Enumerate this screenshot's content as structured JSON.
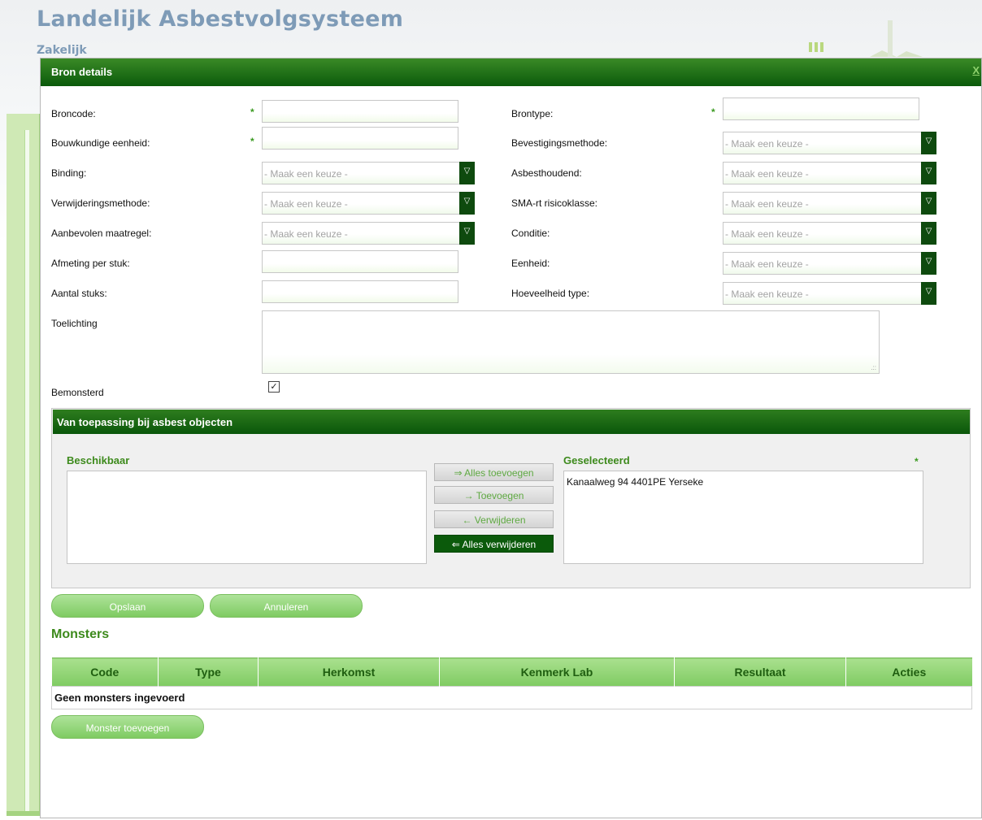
{
  "app": {
    "title": "Landelijk Asbestvolgsysteem",
    "subtitle": "Zakelijk"
  },
  "dialog": {
    "title": "Bron details",
    "close_label": "X"
  },
  "form": {
    "select_placeholder": "- Maak een keuze -",
    "fields": {
      "broncode": {
        "label": "Broncode:",
        "value": ""
      },
      "bouwkundige_eenheid": {
        "label": "Bouwkundige eenheid:",
        "value": ""
      },
      "binding": {
        "label": "Binding:",
        "value": "- Maak een keuze -"
      },
      "verwijderingsmethode": {
        "label": "Verwijderingsmethode:",
        "value": "- Maak een keuze -"
      },
      "aanbevolen_maatregel": {
        "label": "Aanbevolen maatregel:",
        "value": "- Maak een keuze -"
      },
      "afmeting_per_stuk": {
        "label": "Afmeting per stuk:",
        "value": ""
      },
      "aantal_stuks": {
        "label": "Aantal stuks:",
        "value": ""
      },
      "toelichting": {
        "label": "Toelichting",
        "value": ""
      },
      "bemonsterd": {
        "label": "Bemonsterd",
        "checked": true
      },
      "brontype": {
        "label": "Brontype:",
        "value": ""
      },
      "bevestigingsmethode": {
        "label": "Bevestigingsmethode:",
        "value": "- Maak een keuze -"
      },
      "asbesthoudend": {
        "label": "Asbesthoudend:",
        "value": "- Maak een keuze -"
      },
      "sma_rt_risicoklasse": {
        "label": "SMA-rt risicoklasse:",
        "value": "- Maak een keuze -"
      },
      "conditie": {
        "label": "Conditie:",
        "value": "- Maak een keuze -"
      },
      "eenheid": {
        "label": "Eenheid:",
        "value": "- Maak een keuze -"
      },
      "hoeveelheid_type": {
        "label": "Hoeveelheid type:",
        "value": "- Maak een keuze -"
      }
    },
    "required_marker": "*"
  },
  "objects_panel": {
    "title": "Van toepassing bij asbest objecten",
    "available_title": "Beschikbaar",
    "available_items": [],
    "selected_title": "Geselecteerd",
    "selected_items": [
      "Kanaalweg 94 4401PE Yerseke"
    ],
    "buttons": {
      "add_all": "⇒ Alles toevoegen",
      "add": "→ Toevoegen",
      "remove": "← Verwijderen",
      "remove_all": "⇐ Alles verwijderen"
    }
  },
  "actions": {
    "save": "Opslaan",
    "cancel": "Annuleren"
  },
  "monsters": {
    "title": "Monsters",
    "columns": [
      "Code",
      "Type",
      "Herkomst",
      "Kenmerk Lab",
      "Resultaat",
      "Acties"
    ],
    "empty_text": "Geen monsters ingevoerd",
    "add_button": "Monster toevoegen"
  },
  "colors": {
    "header_dark_green": "#0b5a0b",
    "accent_green": "#3d8a1c",
    "pill_green": "#7fcb62",
    "title_blue": "#7e9bb7"
  }
}
